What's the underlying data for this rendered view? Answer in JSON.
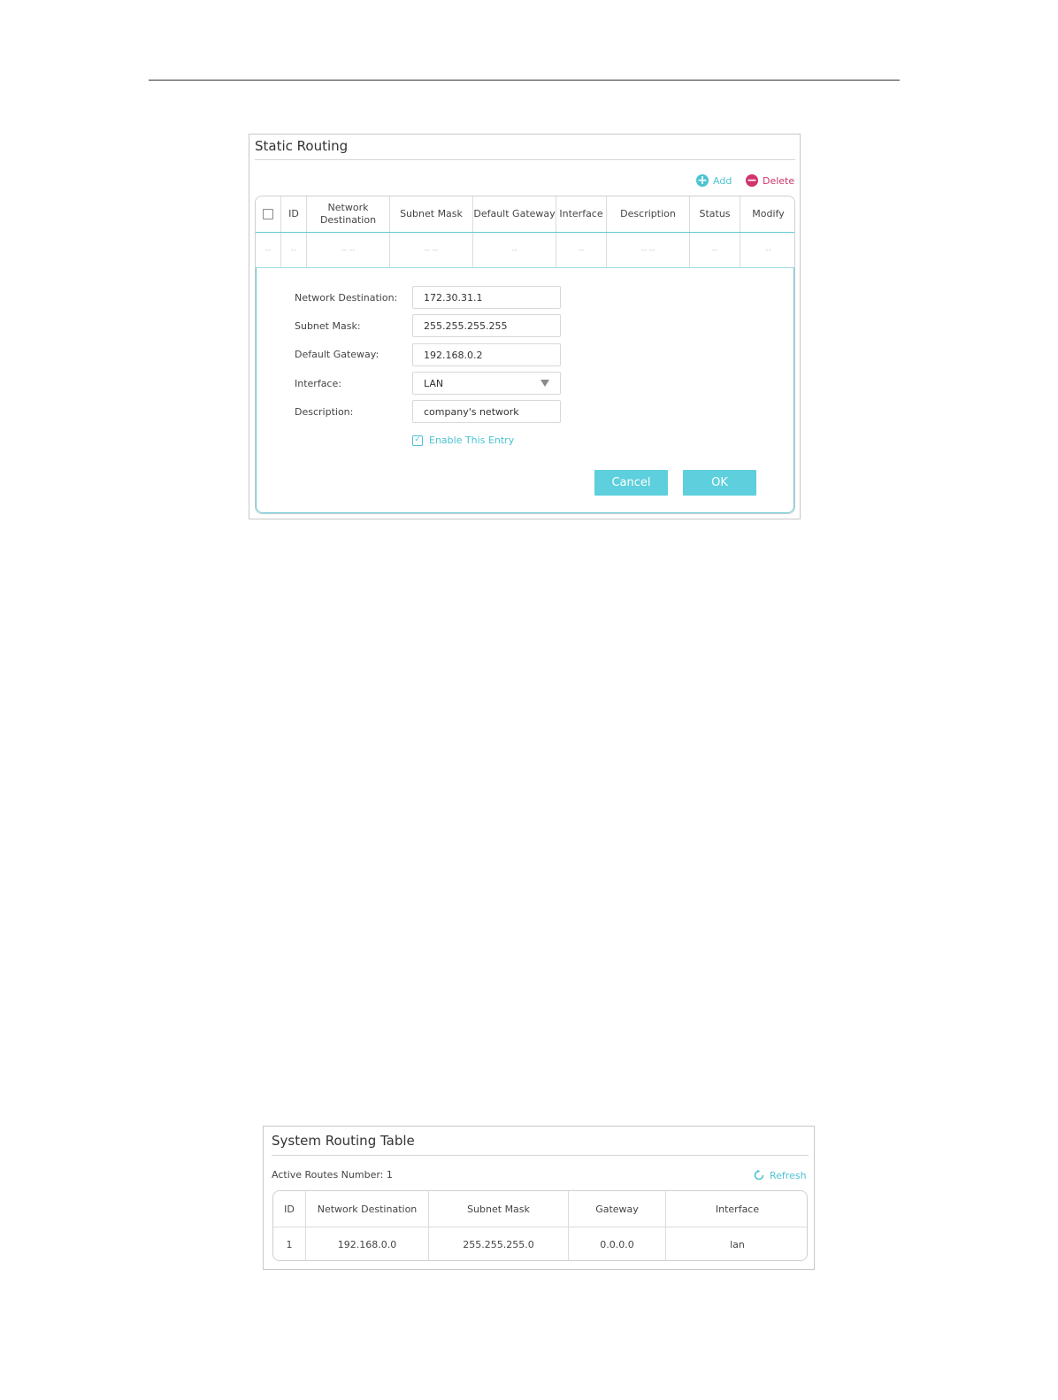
{
  "static_routing": {
    "title": "Static Routing",
    "toolbar": {
      "add_label": "Add",
      "delete_label": "Delete",
      "add_color": "#4cc3d2",
      "delete_color": "#d1346c"
    },
    "columns": [
      "ID",
      "Network Destination",
      "Subnet Mask",
      "Default Gateway",
      "Interface",
      "Description",
      "Status",
      "Modify"
    ],
    "placeholder_row": [
      "--",
      "--",
      "-- --",
      "-- --",
      "--",
      "--",
      "-- --",
      "--",
      "--"
    ],
    "form": {
      "network_destination_label": "Network Destination:",
      "network_destination_value": "172.30.31.1",
      "subnet_mask_label": "Subnet Mask:",
      "subnet_mask_value": "255.255.255.255",
      "default_gateway_label": "Default Gateway:",
      "default_gateway_value": "192.168.0.2",
      "interface_label": "Interface:",
      "interface_value": "LAN",
      "description_label": "Description:",
      "description_value": "company's network",
      "enable_label": "Enable This Entry",
      "enable_checked": true
    },
    "cancel_label": "Cancel",
    "ok_label": "OK",
    "accent_color": "#5ecfdc"
  },
  "system_routing": {
    "title": "System Routing Table",
    "active_routes_label": "Active Routes Number: 1",
    "refresh_label": "Refresh",
    "columns": [
      "ID",
      "Network Destination",
      "Subnet Mask",
      "Gateway",
      "Interface"
    ],
    "rows": [
      [
        "1",
        "192.168.0.0",
        "255.255.255.0",
        "0.0.0.0",
        "lan"
      ]
    ]
  }
}
